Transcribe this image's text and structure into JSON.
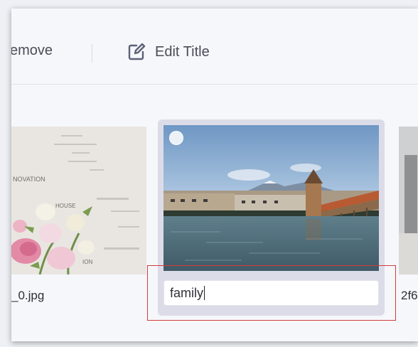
{
  "toolbar": {
    "remove_label": "emove",
    "edit_title_label": "Edit Title",
    "edit_icon": "edit-square-icon"
  },
  "gallery": {
    "left_tile": {
      "caption": "_0.jpg",
      "image_text_1": "NOVATION",
      "image_text_2": "HOUSE",
      "image_text_3": "ION"
    },
    "selected_tile": {
      "title_input_value": "family"
    },
    "right_tile": {
      "caption": "2f6"
    }
  },
  "colors": {
    "highlight": "#d03c3c",
    "accent_icon": "#5b6275"
  }
}
